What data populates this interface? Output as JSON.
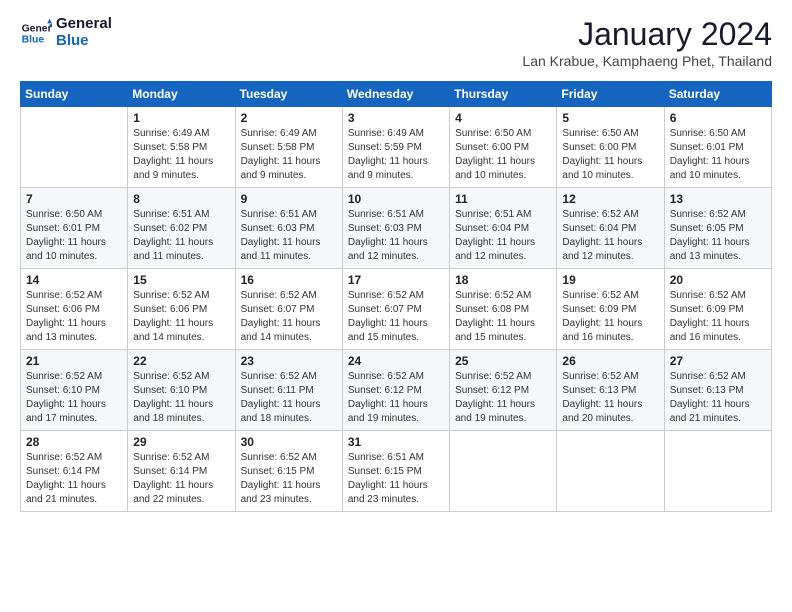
{
  "header": {
    "logo_line1": "General",
    "logo_line2": "Blue",
    "month": "January 2024",
    "location": "Lan Krabue, Kamphaeng Phet, Thailand"
  },
  "days_of_week": [
    "Sunday",
    "Monday",
    "Tuesday",
    "Wednesday",
    "Thursday",
    "Friday",
    "Saturday"
  ],
  "weeks": [
    [
      {
        "day": "",
        "info": ""
      },
      {
        "day": "1",
        "info": "Sunrise: 6:49 AM\nSunset: 5:58 PM\nDaylight: 11 hours\nand 9 minutes."
      },
      {
        "day": "2",
        "info": "Sunrise: 6:49 AM\nSunset: 5:58 PM\nDaylight: 11 hours\nand 9 minutes."
      },
      {
        "day": "3",
        "info": "Sunrise: 6:49 AM\nSunset: 5:59 PM\nDaylight: 11 hours\nand 9 minutes."
      },
      {
        "day": "4",
        "info": "Sunrise: 6:50 AM\nSunset: 6:00 PM\nDaylight: 11 hours\nand 10 minutes."
      },
      {
        "day": "5",
        "info": "Sunrise: 6:50 AM\nSunset: 6:00 PM\nDaylight: 11 hours\nand 10 minutes."
      },
      {
        "day": "6",
        "info": "Sunrise: 6:50 AM\nSunset: 6:01 PM\nDaylight: 11 hours\nand 10 minutes."
      }
    ],
    [
      {
        "day": "7",
        "info": "Sunrise: 6:50 AM\nSunset: 6:01 PM\nDaylight: 11 hours\nand 10 minutes."
      },
      {
        "day": "8",
        "info": "Sunrise: 6:51 AM\nSunset: 6:02 PM\nDaylight: 11 hours\nand 11 minutes."
      },
      {
        "day": "9",
        "info": "Sunrise: 6:51 AM\nSunset: 6:03 PM\nDaylight: 11 hours\nand 11 minutes."
      },
      {
        "day": "10",
        "info": "Sunrise: 6:51 AM\nSunset: 6:03 PM\nDaylight: 11 hours\nand 12 minutes."
      },
      {
        "day": "11",
        "info": "Sunrise: 6:51 AM\nSunset: 6:04 PM\nDaylight: 11 hours\nand 12 minutes."
      },
      {
        "day": "12",
        "info": "Sunrise: 6:52 AM\nSunset: 6:04 PM\nDaylight: 11 hours\nand 12 minutes."
      },
      {
        "day": "13",
        "info": "Sunrise: 6:52 AM\nSunset: 6:05 PM\nDaylight: 11 hours\nand 13 minutes."
      }
    ],
    [
      {
        "day": "14",
        "info": "Sunrise: 6:52 AM\nSunset: 6:06 PM\nDaylight: 11 hours\nand 13 minutes."
      },
      {
        "day": "15",
        "info": "Sunrise: 6:52 AM\nSunset: 6:06 PM\nDaylight: 11 hours\nand 14 minutes."
      },
      {
        "day": "16",
        "info": "Sunrise: 6:52 AM\nSunset: 6:07 PM\nDaylight: 11 hours\nand 14 minutes."
      },
      {
        "day": "17",
        "info": "Sunrise: 6:52 AM\nSunset: 6:07 PM\nDaylight: 11 hours\nand 15 minutes."
      },
      {
        "day": "18",
        "info": "Sunrise: 6:52 AM\nSunset: 6:08 PM\nDaylight: 11 hours\nand 15 minutes."
      },
      {
        "day": "19",
        "info": "Sunrise: 6:52 AM\nSunset: 6:09 PM\nDaylight: 11 hours\nand 16 minutes."
      },
      {
        "day": "20",
        "info": "Sunrise: 6:52 AM\nSunset: 6:09 PM\nDaylight: 11 hours\nand 16 minutes."
      }
    ],
    [
      {
        "day": "21",
        "info": "Sunrise: 6:52 AM\nSunset: 6:10 PM\nDaylight: 11 hours\nand 17 minutes."
      },
      {
        "day": "22",
        "info": "Sunrise: 6:52 AM\nSunset: 6:10 PM\nDaylight: 11 hours\nand 18 minutes."
      },
      {
        "day": "23",
        "info": "Sunrise: 6:52 AM\nSunset: 6:11 PM\nDaylight: 11 hours\nand 18 minutes."
      },
      {
        "day": "24",
        "info": "Sunrise: 6:52 AM\nSunset: 6:12 PM\nDaylight: 11 hours\nand 19 minutes."
      },
      {
        "day": "25",
        "info": "Sunrise: 6:52 AM\nSunset: 6:12 PM\nDaylight: 11 hours\nand 19 minutes."
      },
      {
        "day": "26",
        "info": "Sunrise: 6:52 AM\nSunset: 6:13 PM\nDaylight: 11 hours\nand 20 minutes."
      },
      {
        "day": "27",
        "info": "Sunrise: 6:52 AM\nSunset: 6:13 PM\nDaylight: 11 hours\nand 21 minutes."
      }
    ],
    [
      {
        "day": "28",
        "info": "Sunrise: 6:52 AM\nSunset: 6:14 PM\nDaylight: 11 hours\nand 21 minutes."
      },
      {
        "day": "29",
        "info": "Sunrise: 6:52 AM\nSunset: 6:14 PM\nDaylight: 11 hours\nand 22 minutes."
      },
      {
        "day": "30",
        "info": "Sunrise: 6:52 AM\nSunset: 6:15 PM\nDaylight: 11 hours\nand 23 minutes."
      },
      {
        "day": "31",
        "info": "Sunrise: 6:51 AM\nSunset: 6:15 PM\nDaylight: 11 hours\nand 23 minutes."
      },
      {
        "day": "",
        "info": ""
      },
      {
        "day": "",
        "info": ""
      },
      {
        "day": "",
        "info": ""
      }
    ]
  ]
}
